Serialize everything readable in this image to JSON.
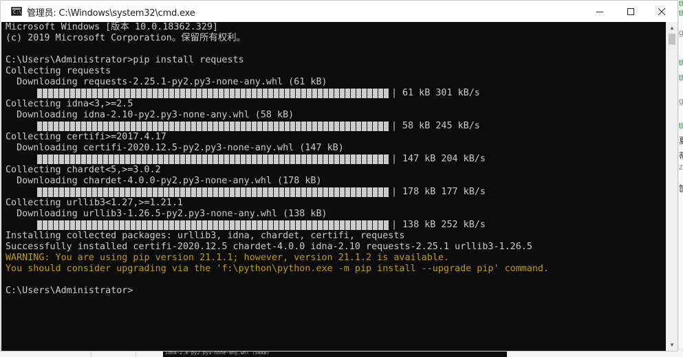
{
  "window": {
    "title": "管理员: C:\\Windows\\system32\\cmd.exe",
    "icon": "cmd-icon"
  },
  "controls": {
    "minimize": "minimize-icon",
    "maximize": "maximize-icon",
    "close": "close-icon"
  },
  "console": {
    "lines": [
      {
        "kind": "text",
        "text": "Microsoft Windows [版本 10.0.18362.329]"
      },
      {
        "kind": "text",
        "text": "(c) 2019 Microsoft Corporation。保留所有权利。"
      },
      {
        "kind": "text",
        "text": ""
      },
      {
        "kind": "text",
        "text": "C:\\Users\\Administrator>pip install requests"
      },
      {
        "kind": "text",
        "text": "Collecting requests"
      },
      {
        "kind": "text",
        "text": "  Downloading requests-2.25.1-py2.py3-none-any.whl (61 kB)"
      },
      {
        "kind": "progress",
        "stats": "61 kB 301 kB/s",
        "fraction": 1.0
      },
      {
        "kind": "text",
        "text": "Collecting idna<3,>=2.5"
      },
      {
        "kind": "text",
        "text": "  Downloading idna-2.10-py2.py3-none-any.whl (58 kB)"
      },
      {
        "kind": "progress",
        "stats": "58 kB 245 kB/s",
        "fraction": 1.0
      },
      {
        "kind": "text",
        "text": "Collecting certifi>=2017.4.17"
      },
      {
        "kind": "text",
        "text": "  Downloading certifi-2020.12.5-py2.py3-none-any.whl (147 kB)"
      },
      {
        "kind": "progress",
        "stats": "147 kB 204 kB/s",
        "fraction": 1.0
      },
      {
        "kind": "text",
        "text": "Collecting chardet<5,>=3.0.2"
      },
      {
        "kind": "text",
        "text": "  Downloading chardet-4.0.0-py2.py3-none-any.whl (178 kB)"
      },
      {
        "kind": "progress",
        "stats": "178 kB 177 kB/s",
        "fraction": 1.0
      },
      {
        "kind": "text",
        "text": "Collecting urllib3<1.27,>=1.21.1"
      },
      {
        "kind": "text",
        "text": "  Downloading urllib3-1.26.5-py2.py3-none-any.whl (138 kB)"
      },
      {
        "kind": "progress",
        "stats": "138 kB 252 kB/s",
        "fraction": 1.0
      },
      {
        "kind": "text",
        "text": "Installing collected packages: urllib3, idna, chardet, certifi, requests"
      },
      {
        "kind": "text",
        "text": "Successfully installed certifi-2020.12.5 chardet-4.0.0 idna-2.10 requests-2.25.1 urllib3-1.26.5"
      },
      {
        "kind": "warn",
        "text": "WARNING: You are using pip version 21.1.1; however, version 21.1.2 is available."
      },
      {
        "kind": "warn",
        "text": "You should consider upgrading via the 'f:\\python\\python.exe -m pip install --upgrade pip' command."
      },
      {
        "kind": "text",
        "text": ""
      },
      {
        "kind": "text",
        "text": "C:\\Users\\Administrator>"
      }
    ],
    "pipe": "|"
  },
  "background": {
    "right_edge_fragments": [
      "th",
      "th",
      "g",
      "th",
      "th",
      "g",
      "tl",
      "夏",
      "蒂",
      "zt",
      "筐"
    ],
    "bottom_strip_text": "idna-2.8-py2.py3-none-any.whl (58kB)"
  },
  "colors": {
    "console_bg": "#0c0c0c",
    "console_fg": "#cccccc",
    "warning": "#c19c00"
  }
}
